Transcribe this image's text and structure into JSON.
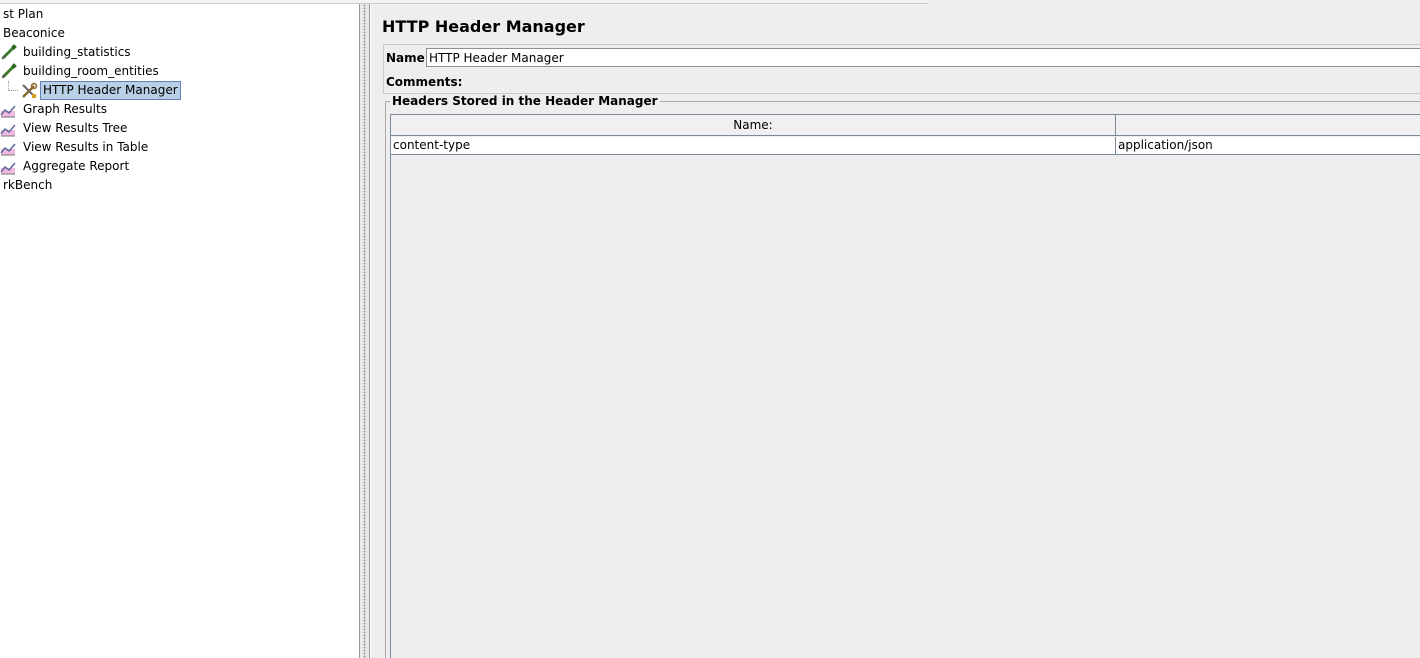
{
  "tree": {
    "items": [
      {
        "label": "st Plan",
        "icon": "test-plan-icon"
      },
      {
        "label": "Beaconice",
        "icon": "thread-group-icon"
      },
      {
        "label": "building_statistics",
        "icon": "sampler-pipette-icon"
      },
      {
        "label": "building_room_entities",
        "icon": "sampler-pipette-icon"
      },
      {
        "label": "HTTP Header Manager",
        "icon": "config-tools-icon"
      },
      {
        "label": "Graph Results",
        "icon": "listener-graph-icon"
      },
      {
        "label": "View Results Tree",
        "icon": "listener-graph-icon"
      },
      {
        "label": "View Results in Table",
        "icon": "listener-graph-icon"
      },
      {
        "label": "Aggregate Report",
        "icon": "listener-graph-icon"
      },
      {
        "label": "rkBench",
        "icon": "workbench-icon"
      }
    ],
    "selected_index": 4
  },
  "panel": {
    "title": "HTTP Header Manager",
    "name_label": "Name:",
    "name_value": "HTTP Header Manager",
    "comments_label": "Comments:",
    "headers_legend": "Headers Stored in the Header Manager"
  },
  "headers_table": {
    "columns": [
      "Name:",
      ""
    ],
    "rows": [
      {
        "name": "content-type",
        "value": "application/json"
      }
    ]
  },
  "colors": {
    "selection_bg": "#b8cfe5",
    "selection_border": "#6382b9",
    "panel_bg": "#eeeeee"
  }
}
